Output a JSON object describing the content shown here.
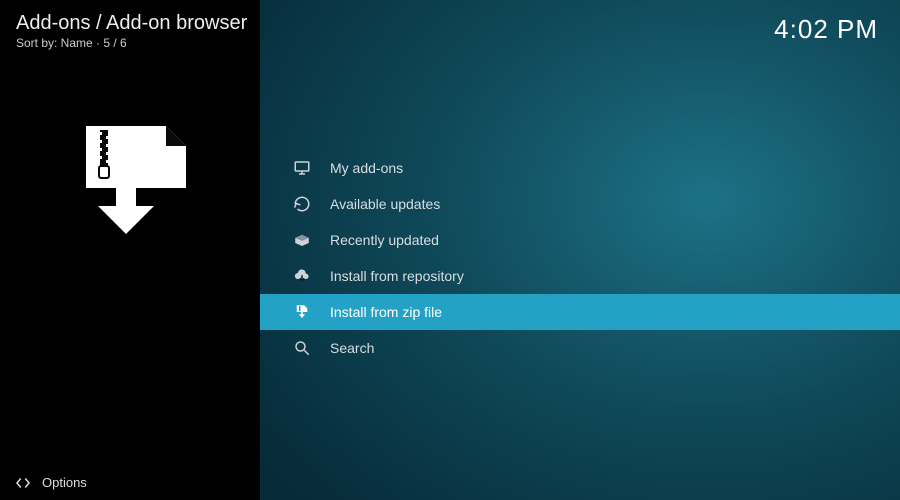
{
  "header": {
    "breadcrumb": "Add-ons / Add-on browser",
    "sort_line": "Sort by: Name  ·  5 / 6",
    "clock": "4:02 PM"
  },
  "sidebar": {
    "icon_name": "zip-download-icon"
  },
  "menu": {
    "items": [
      {
        "label": "My add-ons",
        "icon": "monitor-icon",
        "selected": false
      },
      {
        "label": "Available updates",
        "icon": "refresh-icon",
        "selected": false
      },
      {
        "label": "Recently updated",
        "icon": "open-box-icon",
        "selected": false
      },
      {
        "label": "Install from repository",
        "icon": "cloud-download-icon",
        "selected": false
      },
      {
        "label": "Install from zip file",
        "icon": "zip-file-icon",
        "selected": true
      },
      {
        "label": "Search",
        "icon": "search-icon",
        "selected": false
      }
    ]
  },
  "footer": {
    "options_label": "Options"
  }
}
